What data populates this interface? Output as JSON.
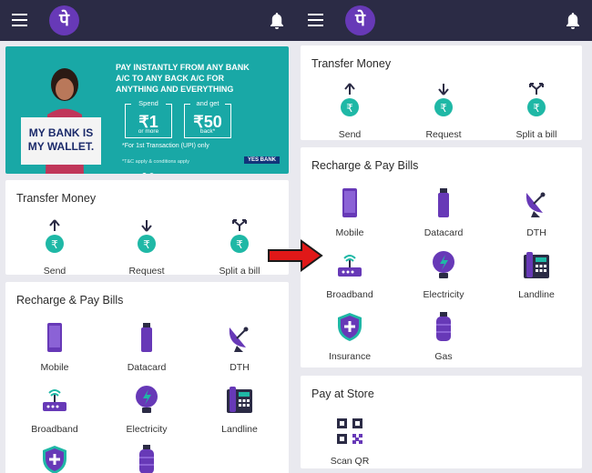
{
  "colors": {
    "topbar": "#2b2b45",
    "brand": "#6739b7",
    "teal": "#1fb8a6",
    "arrow": "#e01818"
  },
  "app": {
    "logo_glyph": "पे"
  },
  "banner": {
    "headline": "PAY INSTANTLY FROM ANY BANK A/C TO ANY BACK A/C FOR ANYTHING AND EVERYTHING",
    "placard": "MY BANK IS MY WALLET.",
    "offer1": {
      "top": "Spend",
      "value": "₹1",
      "sub": "or more"
    },
    "offer2": {
      "top": "and get",
      "value": "₹50",
      "sub": "back*"
    },
    "footnote": "*For 1st Transaction (UPI) only",
    "terms": "*T&C apply & conditions apply",
    "bank_badge": "YES BANK"
  },
  "left": {
    "transfer": {
      "title": "Transfer Money",
      "items": [
        {
          "label": "Send",
          "icon": "send-rupee-icon"
        },
        {
          "label": "Request",
          "icon": "request-rupee-icon"
        },
        {
          "label": "Split a bill",
          "icon": "split-bill-icon"
        }
      ]
    },
    "recharge": {
      "title": "Recharge & Pay Bills",
      "items": [
        {
          "label": "Mobile",
          "icon": "mobile-icon"
        },
        {
          "label": "Datacard",
          "icon": "datacard-icon"
        },
        {
          "label": "DTH",
          "icon": "dth-dish-icon"
        },
        {
          "label": "Broadband",
          "icon": "broadband-router-icon"
        },
        {
          "label": "Electricity",
          "icon": "electricity-bulb-icon"
        },
        {
          "label": "Landline",
          "icon": "landline-phone-icon"
        }
      ]
    }
  },
  "right": {
    "transfer": {
      "title": "Transfer Money",
      "items": [
        {
          "label": "Send",
          "icon": "send-rupee-icon"
        },
        {
          "label": "Request",
          "icon": "request-rupee-icon"
        },
        {
          "label": "Split a bill",
          "icon": "split-bill-icon"
        }
      ]
    },
    "recharge": {
      "title": "Recharge & Pay Bills",
      "items": [
        {
          "label": "Mobile",
          "icon": "mobile-icon"
        },
        {
          "label": "Datacard",
          "icon": "datacard-icon"
        },
        {
          "label": "DTH",
          "icon": "dth-dish-icon"
        },
        {
          "label": "Broadband",
          "icon": "broadband-router-icon"
        },
        {
          "label": "Electricity",
          "icon": "electricity-bulb-icon"
        },
        {
          "label": "Landline",
          "icon": "landline-phone-icon"
        },
        {
          "label": "Insurance",
          "icon": "insurance-shield-icon"
        },
        {
          "label": "Gas",
          "icon": "gas-cylinder-icon"
        }
      ]
    },
    "store": {
      "title": "Pay at Store",
      "items": [
        {
          "label": "Scan QR",
          "icon": "qr-code-icon"
        }
      ]
    }
  }
}
